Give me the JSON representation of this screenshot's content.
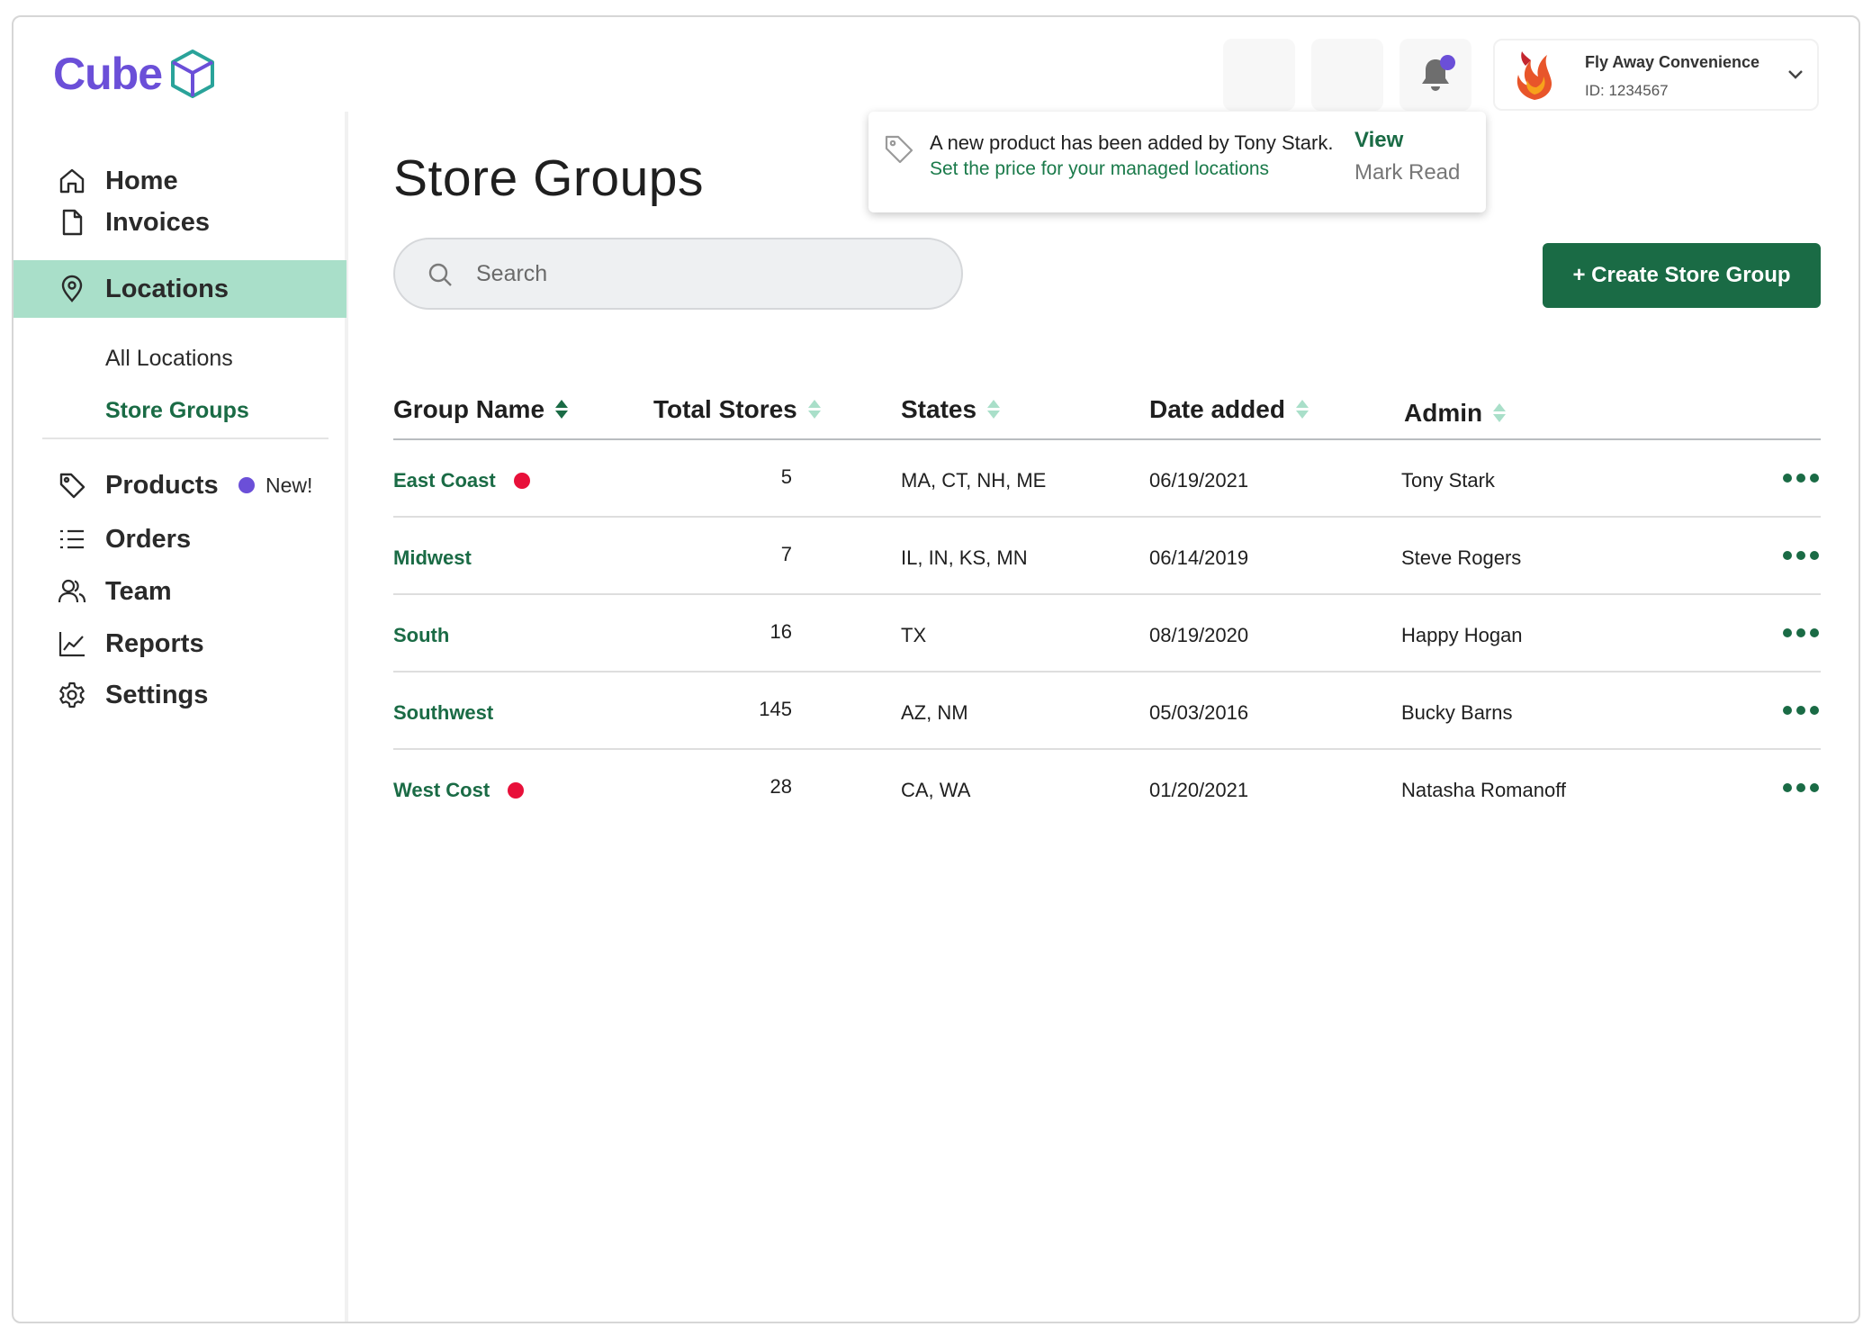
{
  "brand": {
    "name": "Cube"
  },
  "sidebar": {
    "items": [
      {
        "id": "home",
        "label": "Home",
        "icon": "home-icon"
      },
      {
        "id": "invoices",
        "label": "Invoices",
        "icon": "document-icon"
      },
      {
        "id": "locations",
        "label": "Locations",
        "icon": "map-pin-icon",
        "active": true
      },
      {
        "id": "products",
        "label": "Products",
        "icon": "tag-icon",
        "badge": "New!"
      },
      {
        "id": "orders",
        "label": "Orders",
        "icon": "list-icon"
      },
      {
        "id": "team",
        "label": "Team",
        "icon": "users-icon"
      },
      {
        "id": "reports",
        "label": "Reports",
        "icon": "chart-line-icon"
      },
      {
        "id": "settings",
        "label": "Settings",
        "icon": "gear-icon"
      }
    ],
    "sub_items": [
      {
        "label": "All Locations"
      },
      {
        "label": "Store Groups",
        "active": true
      }
    ]
  },
  "account": {
    "name": "Fly Away Convenience",
    "id_text": "ID: 1234567"
  },
  "notification": {
    "message": "A new product has been added by Tony Stark.",
    "sub_message": "Set the price for your managed locations",
    "view_label": "View",
    "mark_read_label": "Mark Read"
  },
  "page": {
    "title": "Store Groups"
  },
  "search": {
    "placeholder": "Search"
  },
  "actions": {
    "create_label": "+ Create Store Group"
  },
  "table": {
    "columns": [
      "Group Name",
      "Total Stores",
      "States",
      "Date added",
      "Admin"
    ],
    "rows": [
      {
        "group": "East Coast",
        "stores": "5",
        "states": "MA, CT, NH, ME",
        "date": "06/19/2021",
        "admin": "Tony Stark",
        "flag": true
      },
      {
        "group": "Midwest",
        "stores": "7",
        "states": "IL, IN, KS, MN",
        "date": "06/14/2019",
        "admin": "Steve Rogers",
        "flag": false
      },
      {
        "group": "South",
        "stores": "16",
        "states": "TX",
        "date": "08/19/2020",
        "admin": "Happy Hogan",
        "flag": false
      },
      {
        "group": "Southwest",
        "stores": "145",
        "states": "AZ, NM",
        "date": "05/03/2016",
        "admin": "Bucky Barns",
        "flag": false
      },
      {
        "group": "West Cost",
        "stores": "28",
        "states": "CA, WA",
        "date": "01/20/2021",
        "admin": "Natasha Romanoff",
        "flag": true
      }
    ]
  },
  "colors": {
    "brand_purple": "#6b4fd8",
    "primary_green": "#1a6b45",
    "active_nav_bg": "#a9dfc9",
    "flag_red": "#e8103a"
  }
}
